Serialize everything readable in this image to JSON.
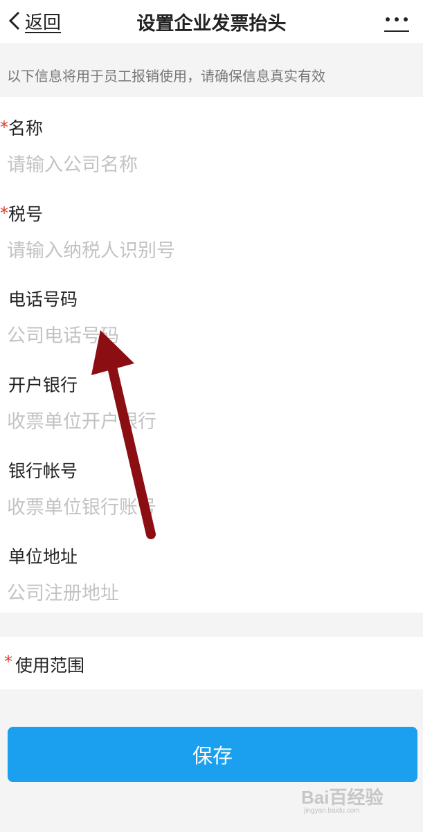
{
  "nav": {
    "back_label": "返回",
    "title": "设置企业发票抬头"
  },
  "notice": "以下信息将用于员工报销使用，请确保信息真实有效",
  "fields": [
    {
      "label": "名称",
      "placeholder": "请输入公司名称",
      "required": true
    },
    {
      "label": "税号",
      "placeholder": "请输入纳税人识别号",
      "required": true
    },
    {
      "label": "电话号码",
      "placeholder": "公司电话号码",
      "required": false
    },
    {
      "label": "开户银行",
      "placeholder": "收票单位开户银行",
      "required": false
    },
    {
      "label": "银行帐号",
      "placeholder": "收票单位银行账号",
      "required": false
    },
    {
      "label": "单位地址",
      "placeholder": "公司注册地址",
      "required": false
    }
  ],
  "scope": {
    "label": "使用范围",
    "required": true
  },
  "save_label": "保存",
  "required_mark": "*",
  "watermark": {
    "brand": "Bai百经验",
    "url": "jingyan.baidu.com"
  },
  "colors": {
    "accent": "#1aa0ee",
    "required": "#e03b2f",
    "arrow": "#8b0e12",
    "background": "#f4f4f4"
  }
}
